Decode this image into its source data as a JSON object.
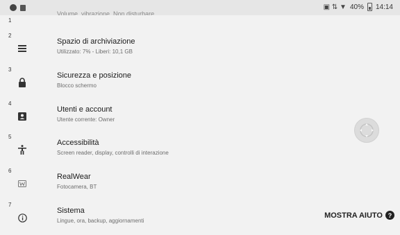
{
  "status_bar": {
    "signal": "▣ ⇅ ▼",
    "battery_percent": "40%",
    "time": "14:14"
  },
  "partial_item": {
    "number": "1",
    "summary": "Volume, vibrazione, Non disturbare"
  },
  "items": [
    {
      "number": "2",
      "icon": "storage-icon",
      "title": "Spazio di archiviazione",
      "summary": "Utilizzato: 7% - Liberi: 10,1 GB"
    },
    {
      "number": "3",
      "icon": "lock-icon",
      "title": "Sicurezza e posizione",
      "summary": "Blocco schermo"
    },
    {
      "number": "4",
      "icon": "account-icon",
      "title": "Utenti e account",
      "summary": "Utente corrente: Owner"
    },
    {
      "number": "5",
      "icon": "accessibility-icon",
      "title": "Accessibilità",
      "summary": "Screen reader, display, controlli di interazione"
    },
    {
      "number": "6",
      "icon": "realwear-icon",
      "title": "RealWear",
      "summary": "Fotocamera, BT"
    },
    {
      "number": "7",
      "icon": "info-icon",
      "title": "Sistema",
      "summary": "Lingue, ora, backup, aggiornamenti"
    }
  ],
  "help_button": {
    "label": "MOSTRA AIUTO",
    "icon_glyph": "?"
  }
}
